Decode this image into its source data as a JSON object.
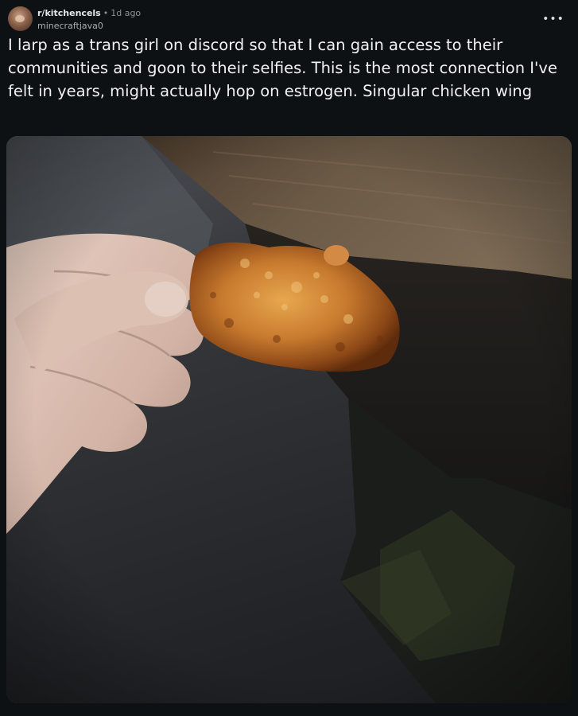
{
  "post": {
    "subreddit": "r/kitchencels",
    "separator": "•",
    "age": "1d ago",
    "username": "minecraftjava0",
    "more_label": "•••",
    "title": "I larp as a trans girl on discord so that I can gain access to their communities and goon to their selfies. This is the most connection I've felt in years, might actually hop on estrogen. Singular chicken wing",
    "image_subject": "hand-holding-chicken-wing"
  },
  "colors": {
    "background": "#0e1113",
    "text": "#f0f2f3",
    "muted": "#8b9196"
  }
}
